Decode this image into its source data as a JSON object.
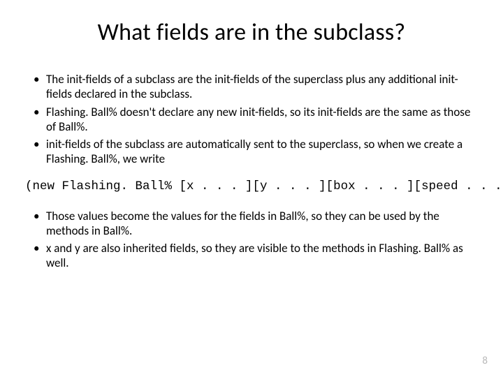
{
  "title": "What fields are in the subclass?",
  "bullets_top": [
    "The init-fields of a subclass are the init-fields of the superclass plus any additional init-fields declared in the subclass.",
    "Flashing. Ball% doesn't declare any new init-fields, so its init-fields are the same as those of Ball%.",
    "init-fields of the subclass are automatically sent to the superclass, so when we create a Flashing. Ball%, we write"
  ],
  "code_line": "(new Flashing. Ball% [x . . . ][y . . . ][box . . . ][speed . . . ])",
  "bullets_bottom": [
    "Those values become the values for the fields in Ball%, so they can be used by the methods in Ball%.",
    "x and y are also inherited fields, so they are visible to the methods in Flashing. Ball% as well."
  ],
  "page_number": "8"
}
